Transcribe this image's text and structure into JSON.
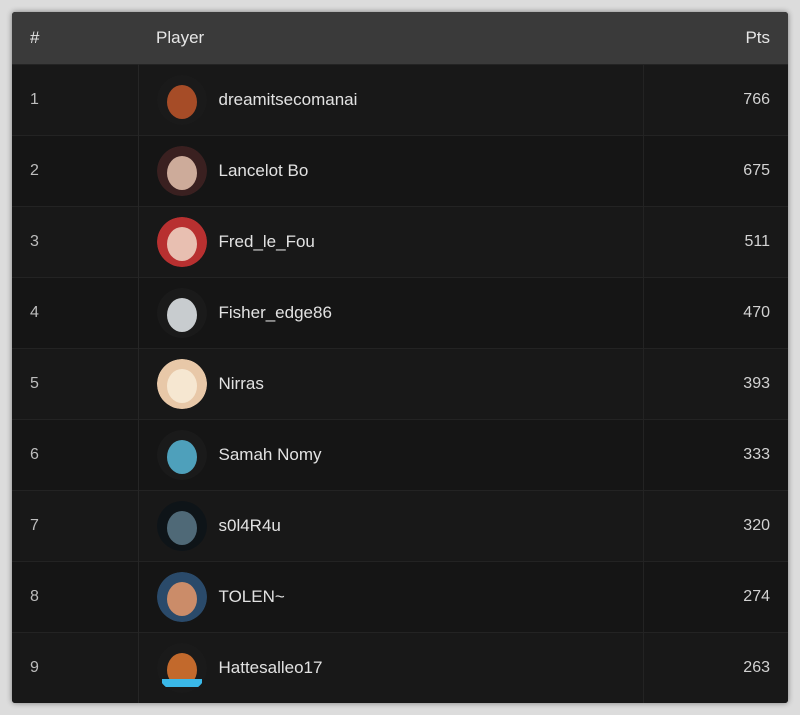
{
  "table": {
    "headers": {
      "rank": "#",
      "player": "Player",
      "pts": "Pts"
    },
    "rows": [
      {
        "rank": "1",
        "player": "dreamitsecomanai",
        "pts": "766",
        "avatar_icon": "fire-character-icon",
        "avatar_colors": [
          "#1a1a1a",
          "#c0562a"
        ]
      },
      {
        "rank": "2",
        "player": "Lancelot Bo",
        "pts": "675",
        "avatar_icon": "anime-character-icon",
        "avatar_colors": [
          "#3a2020",
          "#e8c4b0"
        ]
      },
      {
        "rank": "3",
        "player": "Fred_le_Fou",
        "pts": "511",
        "avatar_icon": "red-hood-character-icon",
        "avatar_colors": [
          "#b83030",
          "#f0d8c8"
        ]
      },
      {
        "rank": "4",
        "player": "Fisher_edge86",
        "pts": "470",
        "avatar_icon": "mushroom-cloud-icon",
        "avatar_colors": [
          "#1a1a1a",
          "#e8ecf0"
        ]
      },
      {
        "rank": "5",
        "player": "Nirras",
        "pts": "393",
        "avatar_icon": "smiling-face-icon",
        "avatar_colors": [
          "#e8c8a8",
          "#f8ecd8"
        ]
      },
      {
        "rank": "6",
        "player": "Samah Nomy",
        "pts": "333",
        "avatar_icon": "neon-ring-icon",
        "avatar_colors": [
          "#1a1a1a",
          "#58b8d8"
        ]
      },
      {
        "rank": "7",
        "player": "s0l4R4u",
        "pts": "320",
        "avatar_icon": "dark-hero-icon",
        "avatar_colors": [
          "#0e1418",
          "#5a7888"
        ]
      },
      {
        "rank": "8",
        "player": "TOLEN~",
        "pts": "274",
        "avatar_icon": "cartoon-scene-icon",
        "avatar_colors": [
          "#2a4a6a",
          "#e89868"
        ]
      },
      {
        "rank": "9",
        "player": "Hattesalleo17",
        "pts": "263",
        "avatar_icon": "sunset-stripes-icon",
        "avatar_colors": [
          "#1a1a1a",
          "#e07830",
          "#3ab8e8"
        ]
      }
    ]
  }
}
